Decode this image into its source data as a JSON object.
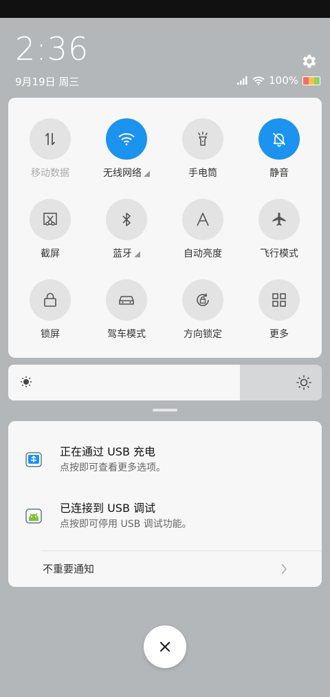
{
  "status_bar": {
    "time": "2:36",
    "date": "9月19日 周三",
    "battery": "100%"
  },
  "colors": {
    "accent": "#1b93ef",
    "background": "#b3b7ba",
    "panel": "#f7f7f7"
  },
  "quick_settings": [
    {
      "label": "移动数据",
      "icon": "mobile-data-icon",
      "active": false,
      "disabled": true
    },
    {
      "label": "无线网络",
      "icon": "wifi-icon",
      "active": true,
      "expand": true
    },
    {
      "label": "手电筒",
      "icon": "flashlight-icon",
      "active": false
    },
    {
      "label": "静音",
      "icon": "bell-mute-icon",
      "active": true
    },
    {
      "label": "截屏",
      "icon": "screenshot-icon",
      "active": false
    },
    {
      "label": "蓝牙",
      "icon": "bluetooth-icon",
      "active": false,
      "expand": true
    },
    {
      "label": "自动亮度",
      "icon": "auto-brightness-icon",
      "active": false
    },
    {
      "label": "飞行模式",
      "icon": "airplane-icon",
      "active": false
    },
    {
      "label": "锁屏",
      "icon": "lock-icon",
      "active": false
    },
    {
      "label": "驾车模式",
      "icon": "car-icon",
      "active": false
    },
    {
      "label": "方向锁定",
      "icon": "rotation-lock-icon",
      "active": false
    },
    {
      "label": "更多",
      "icon": "grid-icon",
      "active": false
    }
  ],
  "brightness": {
    "level": 0.74
  },
  "notifications": [
    {
      "title": "正在通过 USB 充电",
      "subtitle": "点按即可查看更多选项。",
      "icon": "usb-charging-icon"
    },
    {
      "title": "已连接到 USB 调试",
      "subtitle": "点按即可停用 USB 调试功能。",
      "icon": "android-debug-icon"
    }
  ],
  "unimportant_label": "不重要通知"
}
